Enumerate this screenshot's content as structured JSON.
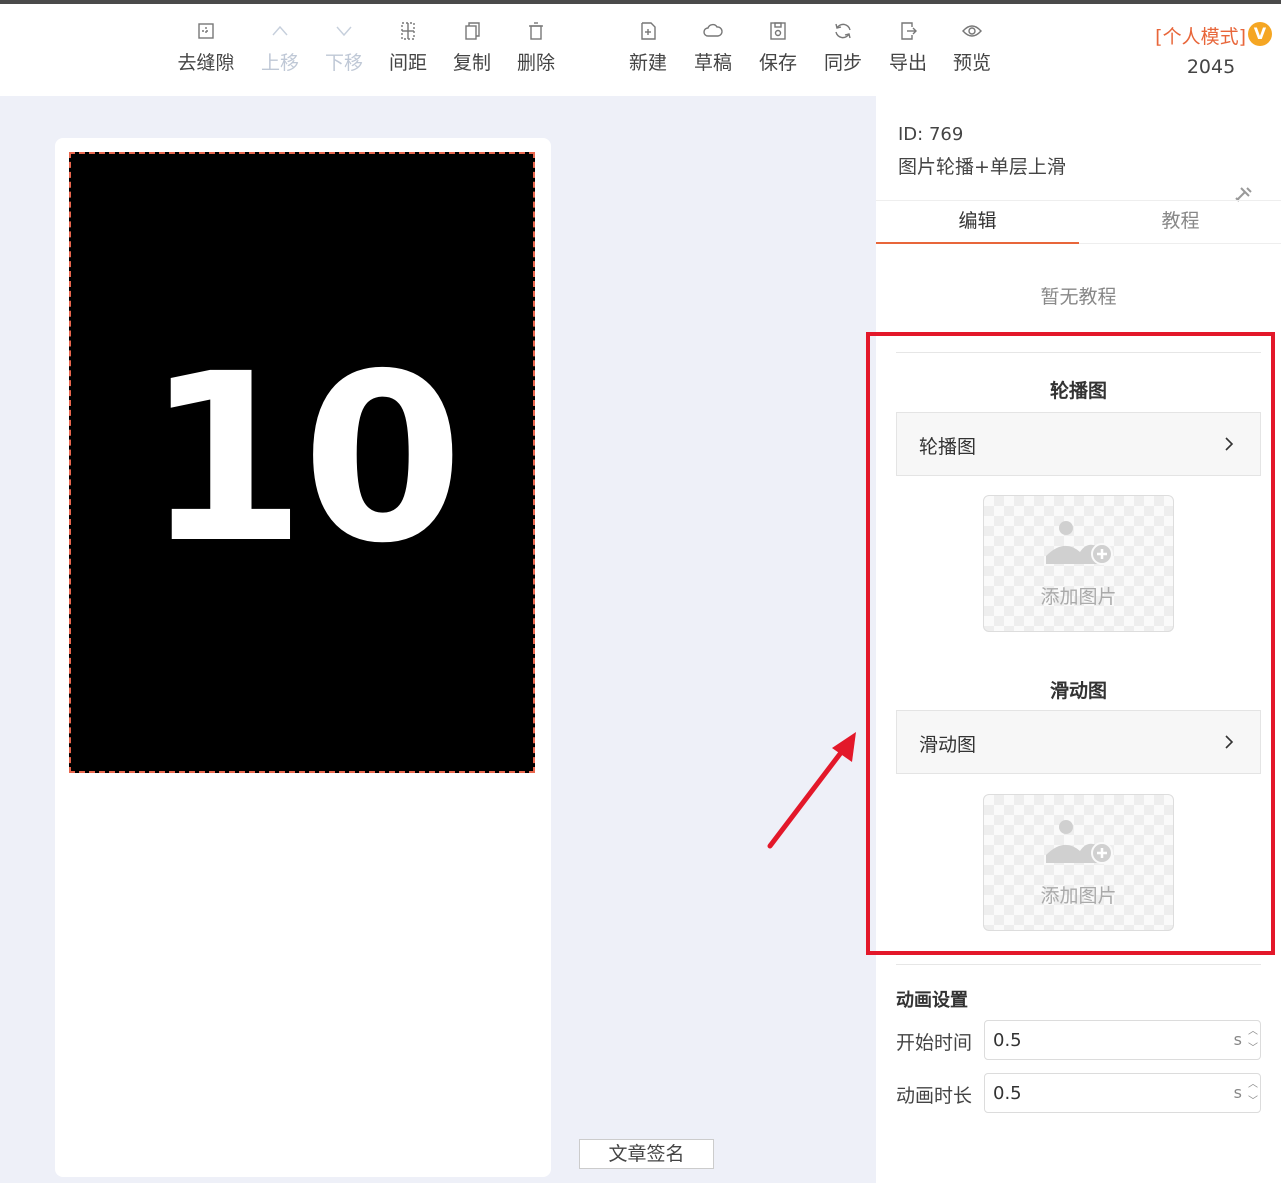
{
  "toolbar": {
    "items": [
      {
        "label": "去缝隙",
        "icon": "merge-gap-icon",
        "disabled": false
      },
      {
        "label": "上移",
        "icon": "chevron-up-icon",
        "disabled": true
      },
      {
        "label": "下移",
        "icon": "chevron-down-icon",
        "disabled": true
      },
      {
        "label": "间距",
        "icon": "spacing-icon",
        "disabled": false
      },
      {
        "label": "复制",
        "icon": "copy-icon",
        "disabled": false
      },
      {
        "label": "删除",
        "icon": "trash-icon",
        "disabled": false
      },
      {
        "label": "新建",
        "icon": "new-file-icon",
        "disabled": false
      },
      {
        "label": "草稿",
        "icon": "cloud-icon",
        "disabled": false
      },
      {
        "label": "保存",
        "icon": "save-icon",
        "disabled": false
      },
      {
        "label": "同步",
        "icon": "sync-icon",
        "disabled": false
      },
      {
        "label": "导出",
        "icon": "export-icon",
        "disabled": false
      },
      {
        "label": "预览",
        "icon": "eye-icon",
        "disabled": false
      }
    ],
    "mode_label": "[个人模式]",
    "vip_badge": "V",
    "count": "2045"
  },
  "canvas": {
    "number": "10",
    "sign_button": "文章签名"
  },
  "panel": {
    "id_label": "ID: 769",
    "name": "图片轮播+单层上滑",
    "tabs": [
      {
        "label": "编辑",
        "active": true
      },
      {
        "label": "教程",
        "active": false
      }
    ],
    "no_tutorial": "暂无教程",
    "carousel": {
      "title": "轮播图",
      "row_label": "轮播图",
      "add_image": "添加图片"
    },
    "slide": {
      "title": "滑动图",
      "row_label": "滑动图",
      "add_image": "添加图片"
    },
    "animation": {
      "title": "动画设置",
      "start_label": "开始时间",
      "start_value": "0.5",
      "duration_label": "动画时长",
      "duration_value": "0.5",
      "unit": "s"
    }
  },
  "colors": {
    "accent": "#e8663a",
    "highlight": "#e3182a",
    "canvas_bg": "#eef0f8"
  }
}
